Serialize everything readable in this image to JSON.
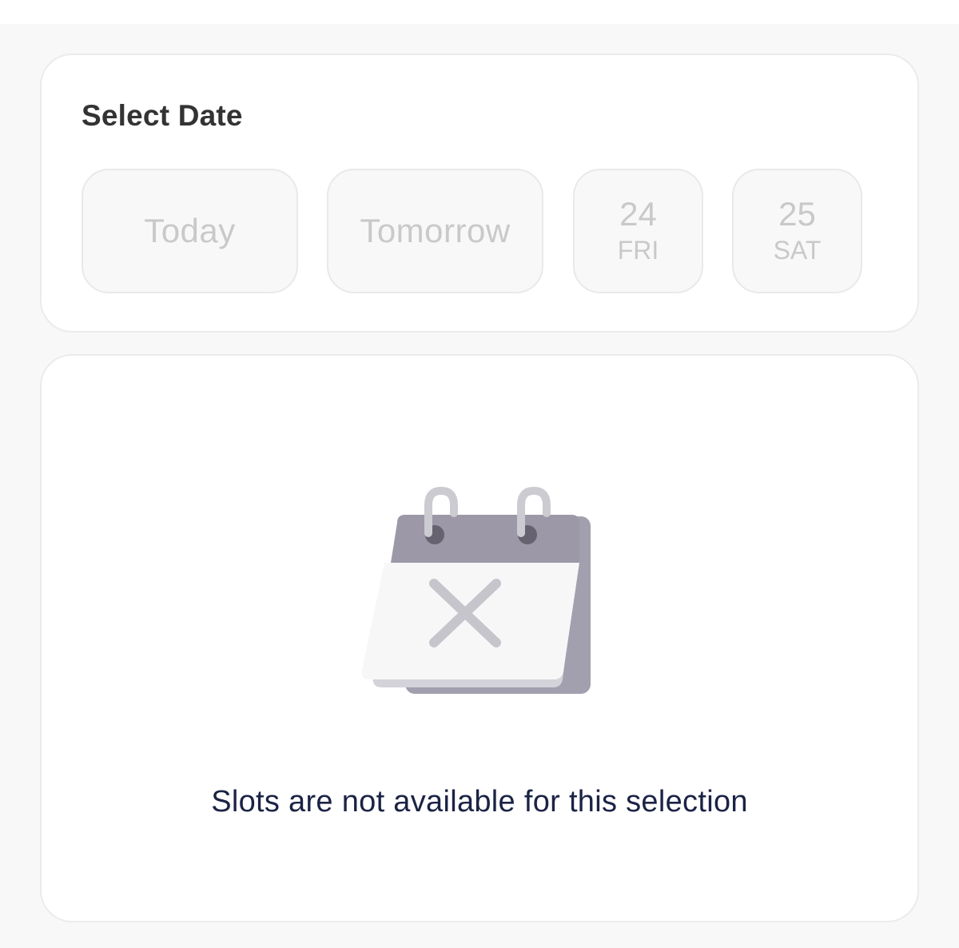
{
  "date_selector": {
    "title": "Select Date",
    "chips": [
      {
        "label": "Today"
      },
      {
        "label": "Tomorrow"
      },
      {
        "day": "24",
        "weekday": "FRI"
      },
      {
        "day": "25",
        "weekday": "SAT"
      }
    ]
  },
  "slots": {
    "empty_icon": "calendar-cross-icon",
    "empty_message": "Slots are not available for this selection"
  },
  "colors": {
    "page_background": "#f8f8f8",
    "card_background": "#ffffff",
    "chip_background": "#f8f8f8",
    "chip_text_disabled": "#c9c9c9",
    "title_text": "#333333",
    "message_text": "#1b2345",
    "icon_header": "#9c98a8",
    "icon_page": "#f7f7f7"
  }
}
